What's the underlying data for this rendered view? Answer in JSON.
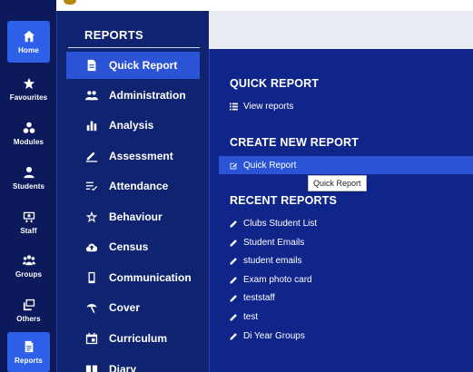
{
  "rail": {
    "items": [
      {
        "label": "Home",
        "icon": "home-icon"
      },
      {
        "label": "Favourites",
        "icon": "star-icon"
      },
      {
        "label": "Modules",
        "icon": "modules-icon"
      },
      {
        "label": "Students",
        "icon": "student-icon"
      },
      {
        "label": "Staff",
        "icon": "staff-icon"
      },
      {
        "label": "Groups",
        "icon": "groups-icon"
      },
      {
        "label": "Others",
        "icon": "others-icon"
      },
      {
        "label": "Reports",
        "icon": "report-icon"
      }
    ]
  },
  "menu": {
    "title": "REPORTS",
    "items": [
      {
        "label": "Quick Report",
        "icon": "document-icon"
      },
      {
        "label": "Administration",
        "icon": "people-icon"
      },
      {
        "label": "Analysis",
        "icon": "bar-chart-icon"
      },
      {
        "label": "Assessment",
        "icon": "pencil-icon"
      },
      {
        "label": "Attendance",
        "icon": "checklist-icon"
      },
      {
        "label": "Behaviour",
        "icon": "star-outline-icon"
      },
      {
        "label": "Census",
        "icon": "cloud-upload-icon"
      },
      {
        "label": "Communication",
        "icon": "phone-icon"
      },
      {
        "label": "Cover",
        "icon": "umbrella-icon"
      },
      {
        "label": "Curriculum",
        "icon": "calendar-icon"
      },
      {
        "label": "Diary",
        "icon": "book-icon"
      }
    ]
  },
  "panel": {
    "quick_report_heading": "QUICK REPORT",
    "view_reports": "View reports",
    "create_heading": "CREATE NEW REPORT",
    "create_link": "Quick Report",
    "tooltip": "Quick Report",
    "recent_heading": "RECENT REPORTS",
    "recent": [
      "Clubs Student List",
      "Student Emails",
      "student emails",
      "Exam photo card",
      "teststaff",
      "test",
      "Di Year Groups"
    ]
  },
  "colors": {
    "rail_bg": "#0c1a5c",
    "active_blue": "#2a53d6",
    "panel_bg": "#10258a"
  }
}
